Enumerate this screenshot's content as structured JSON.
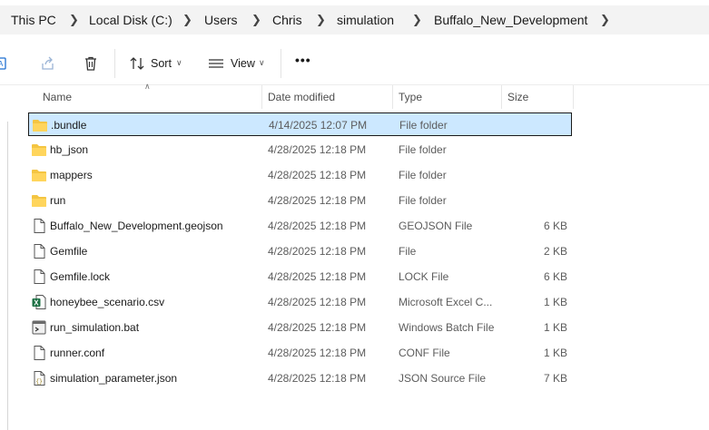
{
  "breadcrumb": [
    "This PC",
    "Local Disk (C:)",
    "Users",
    "Chris",
    "simulation",
    "Buffalo_New_Development"
  ],
  "toolbar": {
    "sort_label": "Sort",
    "view_label": "View",
    "more_label": "•••"
  },
  "columns": {
    "name": "Name",
    "date": "Date modified",
    "type": "Type",
    "size": "Size"
  },
  "files": [
    {
      "name": ".bundle",
      "date": "4/14/2025 12:07 PM",
      "type": "File folder",
      "size": "",
      "icon": "folder-icon",
      "selected": true
    },
    {
      "name": "hb_json",
      "date": "4/28/2025 12:18 PM",
      "type": "File folder",
      "size": "",
      "icon": "folder-icon"
    },
    {
      "name": "mappers",
      "date": "4/28/2025 12:18 PM",
      "type": "File folder",
      "size": "",
      "icon": "folder-icon"
    },
    {
      "name": "run",
      "date": "4/28/2025 12:18 PM",
      "type": "File folder",
      "size": "",
      "icon": "folder-icon"
    },
    {
      "name": "Buffalo_New_Development.geojson",
      "date": "4/28/2025 12:18 PM",
      "type": "GEOJSON File",
      "size": "6 KB",
      "icon": "file-icon"
    },
    {
      "name": "Gemfile",
      "date": "4/28/2025 12:18 PM",
      "type": "File",
      "size": "2 KB",
      "icon": "file-icon"
    },
    {
      "name": "Gemfile.lock",
      "date": "4/28/2025 12:18 PM",
      "type": "LOCK File",
      "size": "6 KB",
      "icon": "file-icon"
    },
    {
      "name": "honeybee_scenario.csv",
      "date": "4/28/2025 12:18 PM",
      "type": "Microsoft Excel C...",
      "size": "1 KB",
      "icon": "excel-icon"
    },
    {
      "name": "run_simulation.bat",
      "date": "4/28/2025 12:18 PM",
      "type": "Windows Batch File",
      "size": "1 KB",
      "icon": "batch-file-icon"
    },
    {
      "name": "runner.conf",
      "date": "4/28/2025 12:18 PM",
      "type": "CONF File",
      "size": "1 KB",
      "icon": "file-icon"
    },
    {
      "name": "simulation_parameter.json",
      "date": "4/28/2025 12:18 PM",
      "type": "JSON Source File",
      "size": "7 KB",
      "icon": "json-file-icon"
    }
  ],
  "colors": {
    "selection": "#cce8ff",
    "folder": "#f4c542",
    "excel": "#1d7044"
  }
}
